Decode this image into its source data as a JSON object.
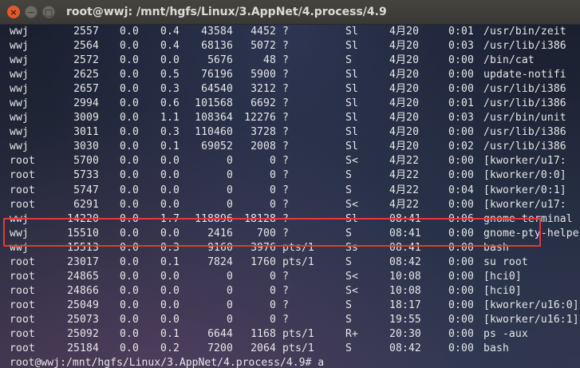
{
  "window": {
    "title": "root@wwj: /mnt/hgfs/Linux/3.AppNet/4.process/4.9",
    "close_glyph": "×",
    "minimize_glyph": "−",
    "maximize_glyph": "□"
  },
  "processes": [
    {
      "user": "wwj",
      "pid": "2557",
      "cpu": "0.0",
      "mem": "0.4",
      "vsz": "43584",
      "rss": "4452",
      "tty": "?",
      "stat": "Sl",
      "start": "4月20",
      "time": "0:01",
      "command": "/usr/bin/zeit"
    },
    {
      "user": "wwj",
      "pid": "2564",
      "cpu": "0.0",
      "mem": "0.4",
      "vsz": "68136",
      "rss": "5072",
      "tty": "?",
      "stat": "Sl",
      "start": "4月20",
      "time": "0:03",
      "command": "/usr/lib/i386"
    },
    {
      "user": "wwj",
      "pid": "2572",
      "cpu": "0.0",
      "mem": "0.0",
      "vsz": "5676",
      "rss": "48",
      "tty": "?",
      "stat": "S",
      "start": "4月20",
      "time": "0:00",
      "command": "/bin/cat"
    },
    {
      "user": "wwj",
      "pid": "2625",
      "cpu": "0.0",
      "mem": "0.5",
      "vsz": "76196",
      "rss": "5900",
      "tty": "?",
      "stat": "Sl",
      "start": "4月20",
      "time": "0:00",
      "command": "update-notifi"
    },
    {
      "user": "wwj",
      "pid": "2657",
      "cpu": "0.0",
      "mem": "0.3",
      "vsz": "64540",
      "rss": "3212",
      "tty": "?",
      "stat": "Sl",
      "start": "4月20",
      "time": "0:00",
      "command": "/usr/lib/i386"
    },
    {
      "user": "wwj",
      "pid": "2994",
      "cpu": "0.0",
      "mem": "0.6",
      "vsz": "101568",
      "rss": "6692",
      "tty": "?",
      "stat": "Sl",
      "start": "4月20",
      "time": "0:01",
      "command": "/usr/lib/i386"
    },
    {
      "user": "wwj",
      "pid": "3009",
      "cpu": "0.0",
      "mem": "1.1",
      "vsz": "108364",
      "rss": "12276",
      "tty": "?",
      "stat": "Sl",
      "start": "4月20",
      "time": "0:03",
      "command": "/usr/bin/unit"
    },
    {
      "user": "wwj",
      "pid": "3011",
      "cpu": "0.0",
      "mem": "0.3",
      "vsz": "110460",
      "rss": "3728",
      "tty": "?",
      "stat": "Sl",
      "start": "4月20",
      "time": "0:00",
      "command": "/usr/lib/i386"
    },
    {
      "user": "wwj",
      "pid": "3030",
      "cpu": "0.0",
      "mem": "0.1",
      "vsz": "69052",
      "rss": "2008",
      "tty": "?",
      "stat": "Sl",
      "start": "4月20",
      "time": "0:02",
      "command": "/usr/lib/i386"
    },
    {
      "user": "root",
      "pid": "5700",
      "cpu": "0.0",
      "mem": "0.0",
      "vsz": "0",
      "rss": "0",
      "tty": "?",
      "stat": "S<",
      "start": "4月22",
      "time": "0:00",
      "command": "[kworker/u17:"
    },
    {
      "user": "root",
      "pid": "5733",
      "cpu": "0.0",
      "mem": "0.0",
      "vsz": "0",
      "rss": "0",
      "tty": "?",
      "stat": "S",
      "start": "4月22",
      "time": "0:00",
      "command": "[kworker/0:0]"
    },
    {
      "user": "root",
      "pid": "5747",
      "cpu": "0.0",
      "mem": "0.0",
      "vsz": "0",
      "rss": "0",
      "tty": "?",
      "stat": "S",
      "start": "4月22",
      "time": "0:04",
      "command": "[kworker/0:1]"
    },
    {
      "user": "root",
      "pid": "6291",
      "cpu": "0.0",
      "mem": "0.0",
      "vsz": "0",
      "rss": "0",
      "tty": "?",
      "stat": "S<",
      "start": "4月22",
      "time": "0:00",
      "command": "[kworker/u17:"
    },
    {
      "user": "wwj",
      "pid": "14220",
      "cpu": "0.0",
      "mem": "1.7",
      "vsz": "118896",
      "rss": "18128",
      "tty": "?",
      "stat": "Sl",
      "start": "08:41",
      "time": "0:06",
      "command": "gnome-terminal"
    },
    {
      "user": "wwj",
      "pid": "15510",
      "cpu": "0.0",
      "mem": "0.0",
      "vsz": "2416",
      "rss": "700",
      "tty": "?",
      "stat": "S",
      "start": "08:41",
      "time": "0:00",
      "command": "gnome-pty-helpe"
    },
    {
      "user": "wwj",
      "pid": "15513",
      "cpu": "0.0",
      "mem": "0.3",
      "vsz": "9160",
      "rss": "3976",
      "tty": "pts/1",
      "stat": "Ss",
      "start": "08:41",
      "time": "0:00",
      "command": "bash"
    },
    {
      "user": "root",
      "pid": "23017",
      "cpu": "0.0",
      "mem": "0.1",
      "vsz": "7824",
      "rss": "1760",
      "tty": "pts/1",
      "stat": "S",
      "start": "08:42",
      "time": "0:00",
      "command": "su root"
    },
    {
      "user": "root",
      "pid": "24865",
      "cpu": "0.0",
      "mem": "0.0",
      "vsz": "0",
      "rss": "0",
      "tty": "?",
      "stat": "S<",
      "start": "10:08",
      "time": "0:00",
      "command": "[hci0]"
    },
    {
      "user": "root",
      "pid": "24866",
      "cpu": "0.0",
      "mem": "0.0",
      "vsz": "0",
      "rss": "0",
      "tty": "?",
      "stat": "S<",
      "start": "10:08",
      "time": "0:00",
      "command": "[hci0]"
    },
    {
      "user": "root",
      "pid": "25049",
      "cpu": "0.0",
      "mem": "0.0",
      "vsz": "0",
      "rss": "0",
      "tty": "?",
      "stat": "S",
      "start": "18:17",
      "time": "0:00",
      "command": "[kworker/u16:0]"
    },
    {
      "user": "root",
      "pid": "25073",
      "cpu": "0.0",
      "mem": "0.0",
      "vsz": "0",
      "rss": "0",
      "tty": "?",
      "stat": "S",
      "start": "19:55",
      "time": "0:00",
      "command": "[kworker/u16:1]"
    },
    {
      "user": "root",
      "pid": "25092",
      "cpu": "0.0",
      "mem": "0.1",
      "vsz": "6644",
      "rss": "1168",
      "tty": "pts/1",
      "stat": "R+",
      "start": "20:30",
      "time": "0:00",
      "command": "ps -aux"
    },
    {
      "user": "root",
      "pid": "25184",
      "cpu": "0.0",
      "mem": "0.2",
      "vsz": "7200",
      "rss": "2064",
      "tty": "pts/1",
      "stat": "S",
      "start": "08:42",
      "time": "0:00",
      "command": "bash"
    }
  ],
  "prompt": {
    "text": "root@wwj:/mnt/hgfs/Linux/3.AppNet/4.process/4.9# a"
  },
  "colors": {
    "highlight_border": "#e03b38",
    "close_button": "#e05a2b",
    "terminal_text": "#e6e6e6"
  }
}
